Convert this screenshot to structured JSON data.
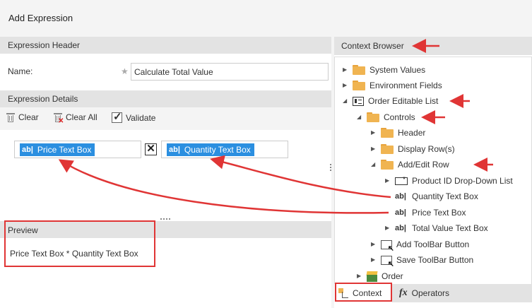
{
  "window": {
    "title": "Add Expression"
  },
  "expression_header": {
    "title": "Expression Header",
    "name_label": "Name:",
    "required_marker": "★",
    "name_value": "Calculate Total Value"
  },
  "expression_details": {
    "title": "Expression Details",
    "toolbar": {
      "clear": "Clear",
      "clear_all": "Clear All",
      "validate": "Validate"
    },
    "tokens": [
      {
        "icon": "ab|",
        "label": "Price Text Box"
      },
      {
        "icon": "ab|",
        "label": "Quantity Text Box"
      }
    ],
    "operator": "✕"
  },
  "preview": {
    "title": "Preview",
    "text": "Price Text Box * Quantity Text Box"
  },
  "context_browser": {
    "title": "Context Browser",
    "tree": [
      {
        "label": "System Values",
        "icon": "folder-icon",
        "expanded": false
      },
      {
        "label": "Environment Fields",
        "icon": "folder-icon",
        "expanded": false
      },
      {
        "label": "Order Editable List",
        "icon": "editable-list-icon",
        "expanded": true
      },
      {
        "label": "Controls",
        "icon": "folder-icon",
        "expanded": true
      },
      {
        "label": "Header",
        "icon": "folder-icon",
        "expanded": false
      },
      {
        "label": "Display Row(s)",
        "icon": "folder-icon",
        "expanded": false
      },
      {
        "label": "Add/Edit Row",
        "icon": "folder-icon",
        "expanded": true
      },
      {
        "label": "Product ID Drop-Down List",
        "icon": "dropdown-icon",
        "expanded": false
      },
      {
        "label": "Quantity Text Box",
        "icon": "text-box-icon",
        "expanded": null
      },
      {
        "label": "Price Text Box",
        "icon": "text-box-icon",
        "expanded": null
      },
      {
        "label": "Total Value Text Box",
        "icon": "text-box-icon",
        "expanded": false
      },
      {
        "label": "Add ToolBar Button",
        "icon": "toolbar-button-icon",
        "expanded": false
      },
      {
        "label": "Save ToolBar Button",
        "icon": "toolbar-button-icon",
        "expanded": false
      },
      {
        "label": "Order",
        "icon": "smartobject-icon",
        "expanded": false
      }
    ],
    "tabs": [
      {
        "label": "Context",
        "icon": "context-icon",
        "active": true
      },
      {
        "label": "Operators",
        "icon": "fx-icon",
        "active": false
      }
    ]
  },
  "colors": {
    "token_blue": "#2b8fe0",
    "annotation_red": "#e03535",
    "header_gray": "#e3e3e3"
  }
}
